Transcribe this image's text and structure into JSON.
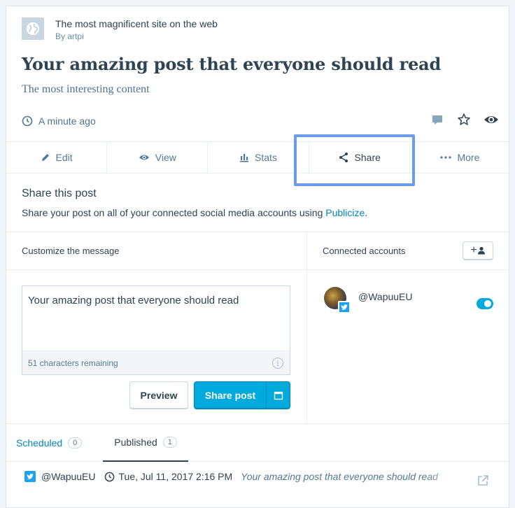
{
  "site": {
    "title": "The most magnificent site on the web",
    "author": "By artpi",
    "icon": "globe-icon"
  },
  "post": {
    "title": "Your amazing post that everyone should read",
    "excerpt": "The most interesting content",
    "time": "A minute ago"
  },
  "actions": {
    "edit": "Edit",
    "view": "View",
    "stats": "Stats",
    "share": "Share",
    "more": "More"
  },
  "share": {
    "title": "Share this post",
    "desc_prefix": "Share your post on all of your connected social media accounts using ",
    "desc_link": "Publicize",
    "desc_suffix": "."
  },
  "message": {
    "heading": "Customize the message",
    "value": "Your amazing post that everyone should read",
    "chars_remaining": "51 characters remaining",
    "info_glyph": "i",
    "preview_label": "Preview",
    "share_label": "Share post"
  },
  "accounts": {
    "heading": "Connected accounts",
    "add_label": "+",
    "items": [
      {
        "name": "@WapuuEU",
        "network": "twitter",
        "enabled": true
      }
    ]
  },
  "tabs": [
    {
      "label": "Scheduled",
      "count": "0"
    },
    {
      "label": "Published",
      "count": "1"
    }
  ],
  "published": {
    "account": "@WapuuEU",
    "date": "Tue, Jul 11, 2017 2:16 PM",
    "message": "Your amazing post that everyone should read"
  },
  "colors": {
    "accent": "#00aadc",
    "link": "#0087be",
    "highlight": "#6d9bec",
    "twitter": "#1da1f2"
  }
}
